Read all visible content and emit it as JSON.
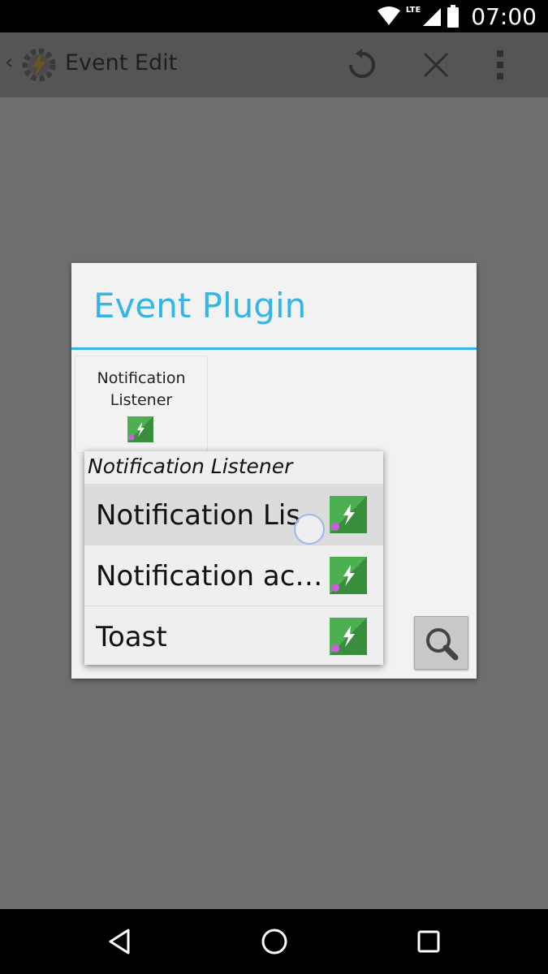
{
  "status_bar": {
    "time": "07:00",
    "network_label": "LTE"
  },
  "app_bar": {
    "title": "Event Edit",
    "icons": [
      "back-chevron-icon",
      "tasker-logo-icon",
      "reset-icon",
      "close-icon",
      "overflow-menu-icon"
    ]
  },
  "dialog": {
    "title": "Event Plugin",
    "accent_color": "#33b5e5",
    "tile": {
      "label": "Notification Listener",
      "icon": "plugin-icon"
    },
    "search_icon": "search-icon"
  },
  "popup": {
    "header": "Notification Listener",
    "items": [
      {
        "label": "Notification Lis",
        "icon": "plugin-icon",
        "selected": true
      },
      {
        "label": "Notification ac…",
        "icon": "plugin-icon",
        "selected": false
      },
      {
        "label": "Toast",
        "icon": "plugin-icon",
        "selected": false
      }
    ]
  },
  "nav_bar": {
    "icons": [
      "nav-back-icon",
      "nav-home-icon",
      "nav-recents-icon"
    ]
  }
}
